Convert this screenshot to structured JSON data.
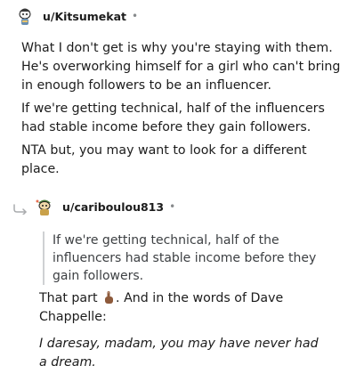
{
  "comments": [
    {
      "username": "u/Kitsumekat",
      "separator": "•",
      "paragraphs": [
        "What I don't get is why you're staying with them. He's overworking himself for a girl who can't bring in enough followers to be an influencer.",
        "If we're getting technical, half of the influencers had stable income before they gain followers.",
        "NTA but, you may want to look for a different place."
      ]
    },
    {
      "username": "u/cariboulou813",
      "separator": "•",
      "quote": "If we're getting technical, half of the influencers had stable income before they gain followers.",
      "line1_before": "That part",
      "line1_after": ". And in the words of Dave Chappelle:",
      "line2": "I daresay, madam, you may have never had a dream."
    }
  ],
  "icons": {
    "avatar1": "snoo-avatar-icon",
    "avatar2": "snoo-avatar-icon",
    "reply": "reply-arrow-icon",
    "emoji": "pointing-up-emoji"
  }
}
